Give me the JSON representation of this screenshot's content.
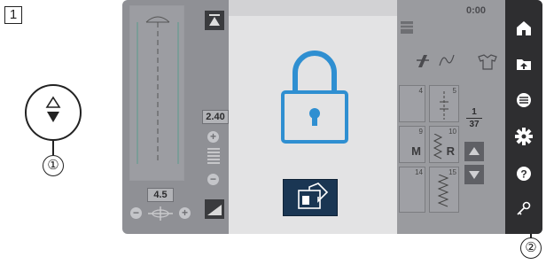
{
  "figure_number": "1",
  "callouts": {
    "one": "①",
    "two": "②"
  },
  "screen": {
    "timer": "0:00",
    "stitch_width_value": "2.40",
    "stitch_length_value": "4.5",
    "page_counter": {
      "current": "1",
      "total": "37"
    },
    "stitch_cells": [
      {
        "number": "4",
        "letter": ""
      },
      {
        "number": "5",
        "letter": ""
      },
      {
        "number": "9",
        "letter": "M"
      },
      {
        "number": "10",
        "letter": "R"
      },
      {
        "number": "14",
        "letter": ""
      },
      {
        "number": "15",
        "letter": ""
      }
    ],
    "right_bar_icons": [
      "home-icon",
      "memory-icon",
      "menu-icon",
      "settings-icon",
      "help-icon",
      "key-icon"
    ]
  },
  "colors": {
    "lock_blue": "#2f8fd1",
    "right_bar": "#2e2e30",
    "return_button": "#1a3653"
  }
}
